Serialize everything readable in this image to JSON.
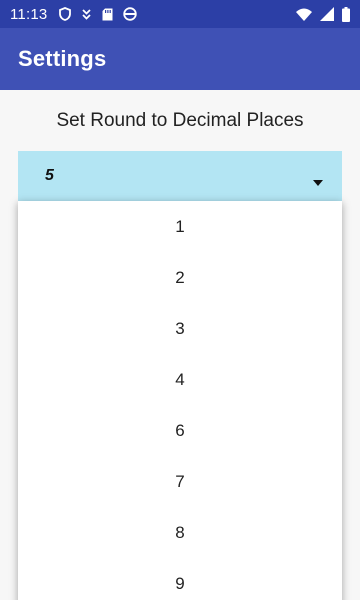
{
  "status_bar": {
    "time": "11:13",
    "left_icons": [
      "shield-icon",
      "download-icon",
      "sd-card-icon",
      "circle-icon"
    ],
    "right_icons": [
      "wifi-icon",
      "signal-icon",
      "battery-icon"
    ]
  },
  "app_bar": {
    "title": "Settings",
    "color": "#3f51b5"
  },
  "settings": {
    "label": "Set Round to Decimal Places",
    "spinner": {
      "selected_value": "5",
      "background_color": "#b3e5f3"
    },
    "dropdown_options": [
      "1",
      "2",
      "3",
      "4",
      "6",
      "7",
      "8",
      "9"
    ]
  }
}
